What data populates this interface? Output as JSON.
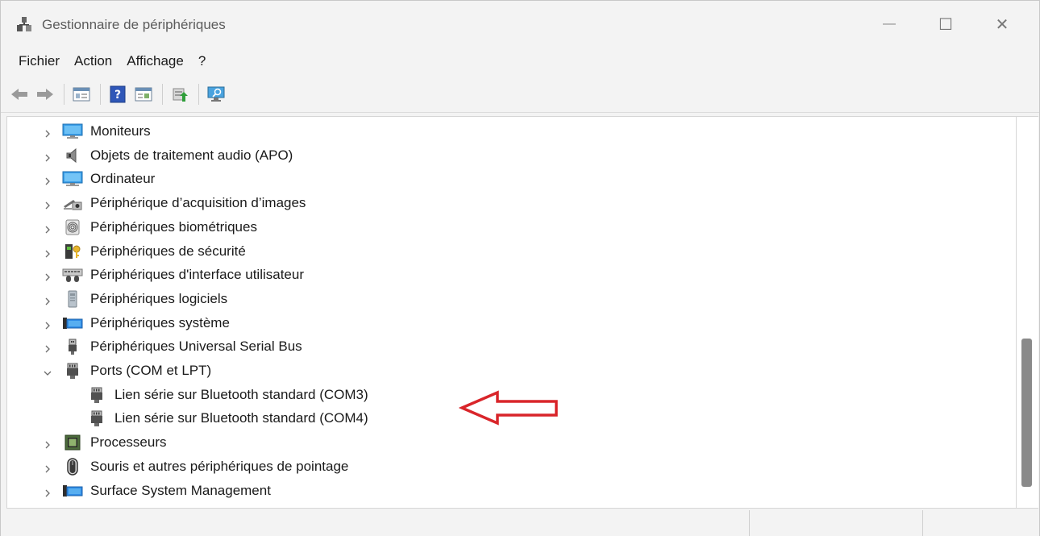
{
  "window": {
    "title": "Gestionnaire de périphériques",
    "minimize_glyph": "—",
    "maximize_glyph": "☐",
    "close_glyph": "✕"
  },
  "menu": [
    {
      "label": "Fichier"
    },
    {
      "label": "Action"
    },
    {
      "label": "Affichage"
    },
    {
      "label": "?"
    }
  ],
  "toolbar": [
    {
      "icon": "back-arrow-icon"
    },
    {
      "icon": "forward-arrow-icon"
    },
    {
      "icon": "show-hide-console-tree-icon"
    },
    {
      "icon": "help-icon"
    },
    {
      "icon": "show-action-pane-icon"
    },
    {
      "icon": "update-driver-icon"
    },
    {
      "icon": "scan-hardware-changes-icon"
    }
  ],
  "tree": [
    {
      "label": "Moniteurs",
      "icon": "monitor-icon",
      "expanded": false,
      "level": 0
    },
    {
      "label": "Objets de traitement audio (APO)",
      "icon": "speaker-icon",
      "expanded": false,
      "level": 0
    },
    {
      "label": "Ordinateur",
      "icon": "computer-icon",
      "expanded": false,
      "level": 0
    },
    {
      "label": "Périphérique d’acquisition d’images",
      "icon": "camera-icon",
      "expanded": false,
      "level": 0
    },
    {
      "label": "Périphériques biométriques",
      "icon": "fingerprint-icon",
      "expanded": false,
      "level": 0
    },
    {
      "label": "Périphériques de sécurité",
      "icon": "security-key-icon",
      "expanded": false,
      "level": 0
    },
    {
      "label": "Périphériques d'interface utilisateur",
      "icon": "hid-icon",
      "expanded": false,
      "level": 0
    },
    {
      "label": "Périphériques logiciels",
      "icon": "software-device-icon",
      "expanded": false,
      "level": 0
    },
    {
      "label": "Périphériques système",
      "icon": "system-device-icon",
      "expanded": false,
      "level": 0
    },
    {
      "label": "Périphériques Universal Serial Bus",
      "icon": "usb-icon",
      "expanded": false,
      "level": 0
    },
    {
      "label": "Ports (COM et LPT)",
      "icon": "port-icon",
      "expanded": true,
      "level": 0
    },
    {
      "label": "Lien série sur Bluetooth standard (COM3)",
      "icon": "port-icon",
      "expanded": null,
      "level": 1
    },
    {
      "label": "Lien série sur Bluetooth standard (COM4)",
      "icon": "port-icon",
      "expanded": null,
      "level": 1
    },
    {
      "label": "Processeurs",
      "icon": "processor-icon",
      "expanded": false,
      "level": 0
    },
    {
      "label": "Souris et autres périphériques de pointage",
      "icon": "mouse-icon",
      "expanded": false,
      "level": 0
    },
    {
      "label": "Surface System Management",
      "icon": "system-device-icon",
      "expanded": false,
      "level": 0
    }
  ],
  "annotation": {
    "icon": "red-arrow-pointer-icon",
    "color": "#d9252a"
  },
  "colors": {
    "accent_blue": "#2e8be6",
    "chevron": "#6b6b6b"
  }
}
